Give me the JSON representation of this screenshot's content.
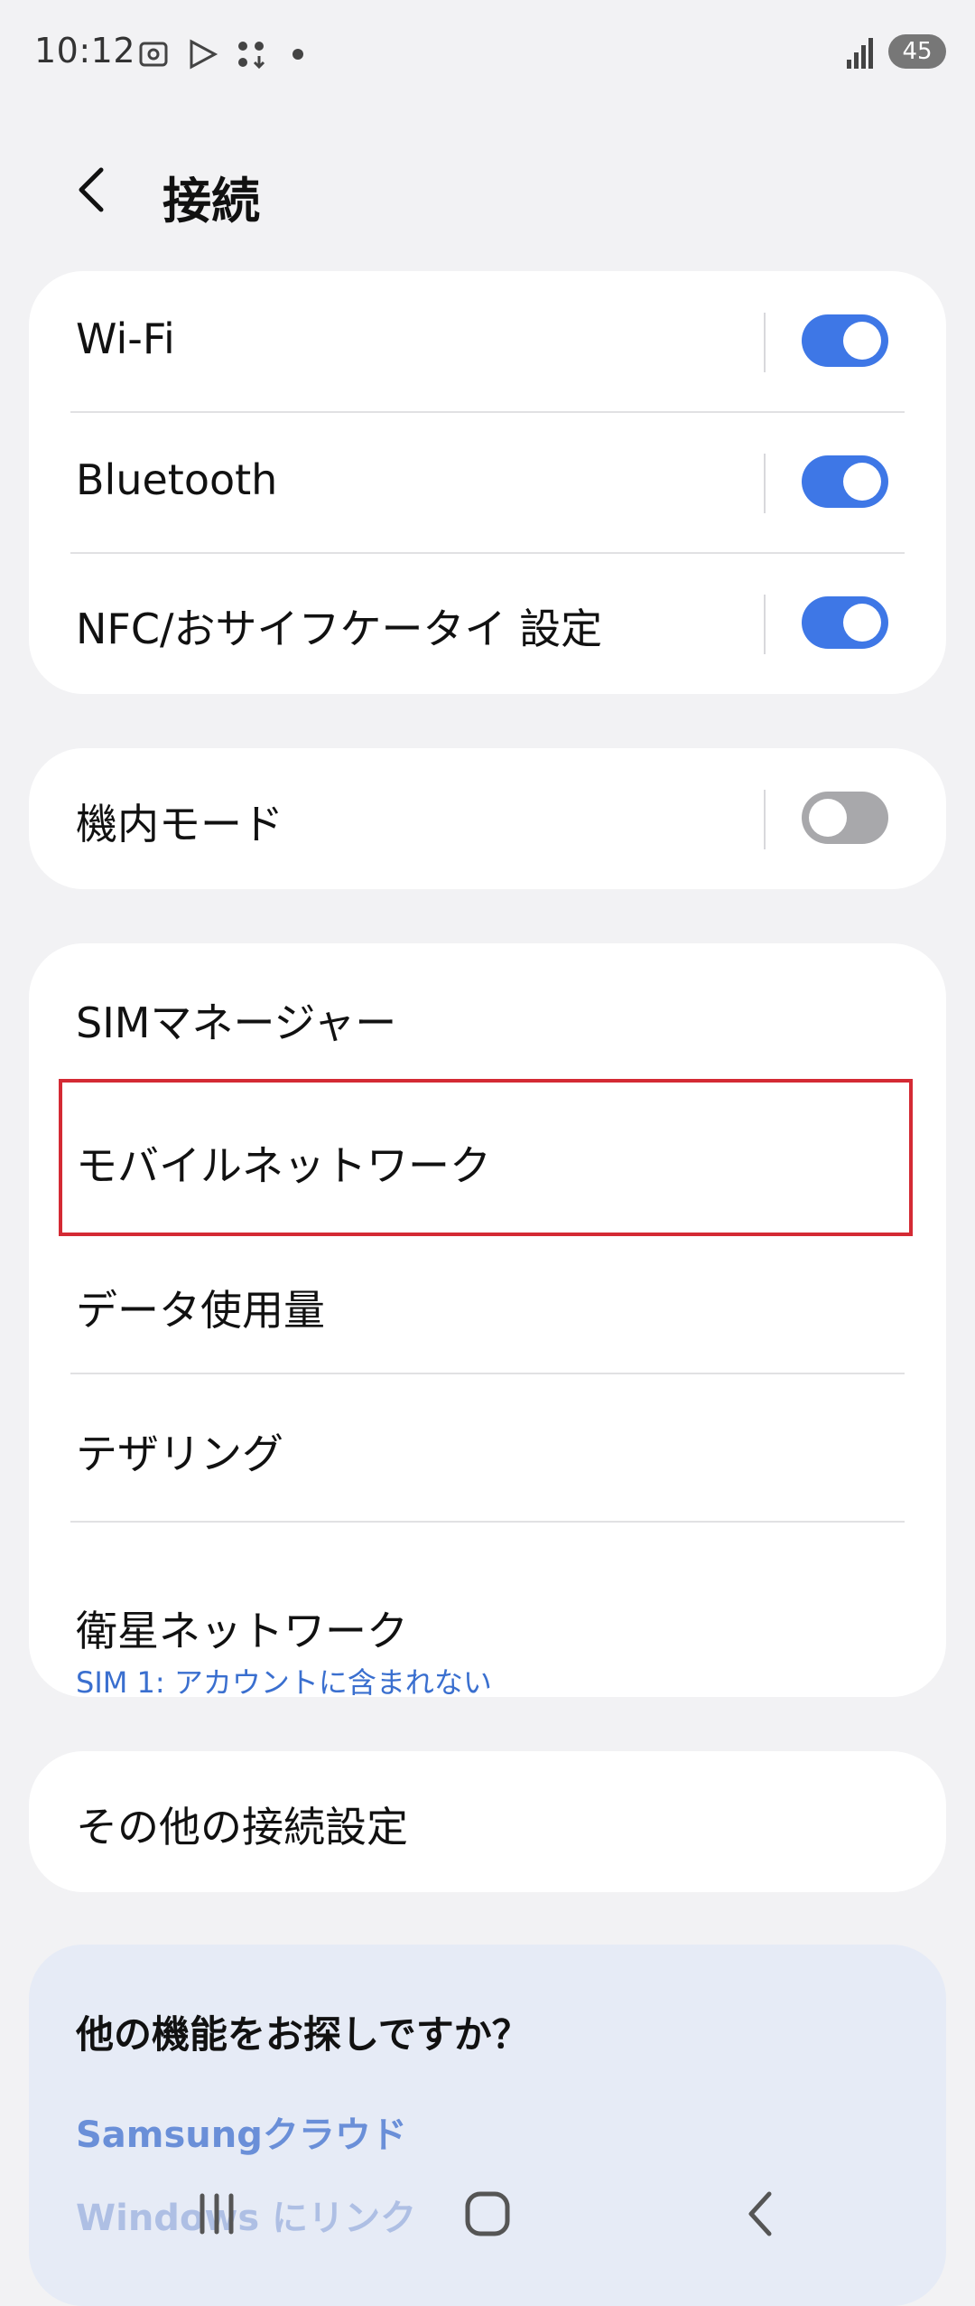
{
  "status_bar": {
    "time": "10:12",
    "icons": [
      "screenshot-icon",
      "play-store-icon",
      "app-download-icon",
      "notification-dot-icon"
    ],
    "battery": "45"
  },
  "header": {
    "title": "接続"
  },
  "connections_group": [
    {
      "label": "Wi-Fi",
      "toggle": "on"
    },
    {
      "label": "Bluetooth",
      "toggle": "on"
    },
    {
      "label": "NFC/おサイフケータイ 設定",
      "toggle": "on"
    }
  ],
  "airplane": {
    "label": "機内モード",
    "toggle": "off"
  },
  "network_group": {
    "sim_manager": "SIMマネージャー",
    "mobile_network": "モバイルネットワーク",
    "data_usage": "データ使用量",
    "tethering": "テザリング",
    "satellite": "衛星ネットワーク",
    "satellite_sub": "SIM 1: アカウントに含まれない"
  },
  "other_settings": {
    "label": "その他の接続設定"
  },
  "more_features": {
    "title": "他の機能をお探しですか？",
    "links": [
      "Samsungクラウド",
      "Windows にリンク"
    ]
  },
  "colors": {
    "accent": "#3e77e6",
    "highlight": "#d42a34",
    "link": "#3a6fcf"
  }
}
